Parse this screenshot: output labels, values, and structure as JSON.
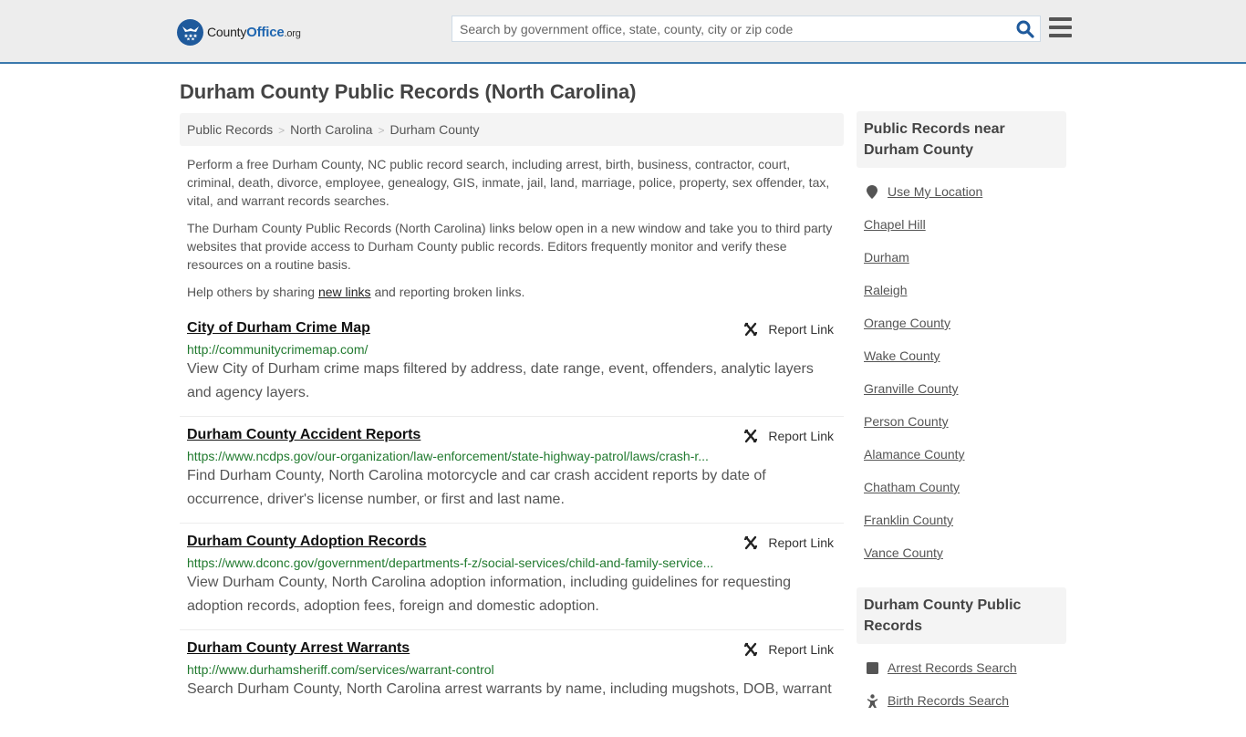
{
  "header": {
    "logo": {
      "prefix": "County",
      "bold": "Office",
      "suffix": ".org"
    },
    "search_placeholder": "Search by government office, state, county, city or zip code",
    "search_value": ""
  },
  "page_title": "Durham County Public Records (North Carolina)",
  "breadcrumb": [
    {
      "label": "Public Records"
    },
    {
      "label": "North Carolina"
    },
    {
      "label": "Durham County"
    }
  ],
  "breadcrumb_separator": ">",
  "intro": {
    "p1": "Perform a free Durham County, NC public record search, including arrest, birth, business, contractor, court, criminal, death, divorce, employee, genealogy, GIS, inmate, jail, land, marriage, police, property, sex offender, tax, vital, and warrant records searches.",
    "p2": "The Durham County Public Records (North Carolina) links below open in a new window and take you to third party websites that provide access to Durham County public records. Editors frequently monitor and verify these resources on a routine basis.",
    "p3_before": "Help others by sharing ",
    "p3_link": "new links",
    "p3_after": " and reporting broken links."
  },
  "report_link_label": "Report Link",
  "records": [
    {
      "title": "City of Durham Crime Map",
      "url": "http://communitycrimemap.com/",
      "description": "View City of Durham crime maps filtered by address, date range, event, offenders, analytic layers and agency layers."
    },
    {
      "title": "Durham County Accident Reports",
      "url": "https://www.ncdps.gov/our-organization/law-enforcement/state-highway-patrol/laws/crash-r...",
      "description": "Find Durham County, North Carolina motorcycle and car crash accident reports by date of occurrence, driver's license number, or first and last name."
    },
    {
      "title": "Durham County Adoption Records",
      "url": "https://www.dconc.gov/government/departments-f-z/social-services/child-and-family-service...",
      "description": "View Durham County, North Carolina adoption information, including guidelines for requesting adoption records, adoption fees, foreign and domestic adoption."
    },
    {
      "title": "Durham County Arrest Warrants",
      "url": "http://www.durhamsheriff.com/services/warrant-control",
      "description": "Search Durham County, North Carolina arrest warrants by name, including mugshots, DOB, warrant"
    }
  ],
  "sidebar": {
    "nearby": {
      "heading": "Public Records near Durham County",
      "use_location": "Use My Location",
      "items": [
        "Chapel Hill",
        "Durham",
        "Raleigh",
        "Orange County",
        "Wake County",
        "Granville County",
        "Person County",
        "Alamance County",
        "Chatham County",
        "Franklin County",
        "Vance County"
      ]
    },
    "county_records": {
      "heading": "Durham County Public Records",
      "items": [
        {
          "label": "Arrest Records Search",
          "icon": "square-icon"
        },
        {
          "label": "Birth Records Search",
          "icon": "baby-icon"
        }
      ]
    }
  },
  "colors": {
    "brand_blue": "#1f5a9c",
    "header_border": "#3b79ad",
    "url_green": "#217a2f",
    "search_icon": "#1f5a9c"
  }
}
